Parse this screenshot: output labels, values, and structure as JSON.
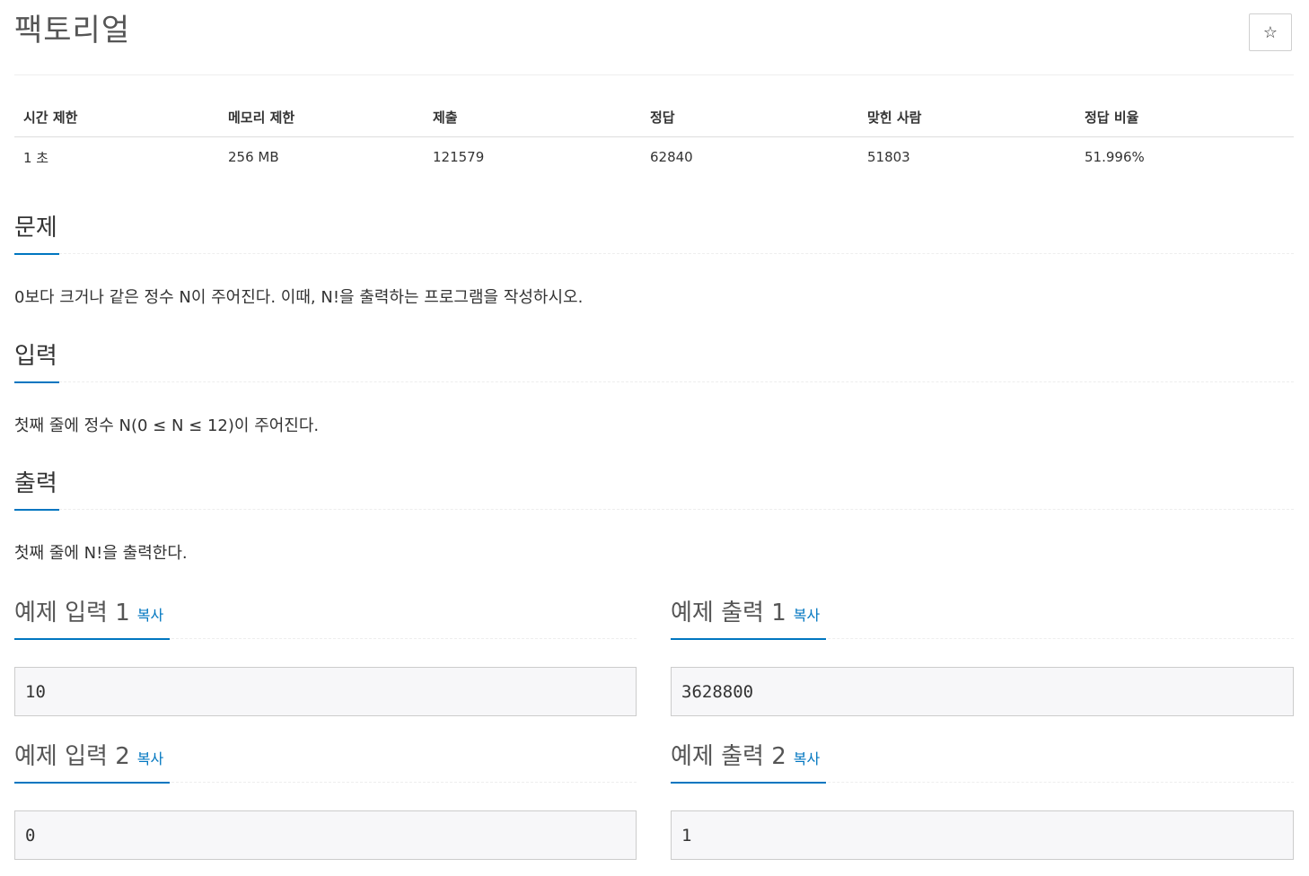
{
  "problem": {
    "title": "팩토리얼",
    "star_icon": "☆"
  },
  "info_table": {
    "headers": [
      "시간 제한",
      "메모리 제한",
      "제출",
      "정답",
      "맞힌 사람",
      "정답 비율"
    ],
    "values": [
      "1 초",
      "256 MB",
      "121579",
      "62840",
      "51803",
      "51.996%"
    ]
  },
  "sections": {
    "description": {
      "heading": "문제",
      "text": "0보다 크거나 같은 정수 N이 주어진다. 이때, N!을 출력하는 프로그램을 작성하시오."
    },
    "input": {
      "heading": "입력",
      "text": "첫째 줄에 정수 N(0 ≤ N ≤ 12)이 주어진다."
    },
    "output": {
      "heading": "출력",
      "text": "첫째 줄에 N!을 출력한다."
    }
  },
  "samples": [
    {
      "input_heading": "예제 입력 1",
      "output_heading": "예제 출력 1",
      "input": "10",
      "output": "3628800"
    },
    {
      "input_heading": "예제 입력 2",
      "output_heading": "예제 출력 2",
      "input": "0",
      "output": "1"
    }
  ],
  "copy_label": "복사",
  "colors": {
    "accent": "#0076c0",
    "sample_bg": "#f7f7f9"
  }
}
